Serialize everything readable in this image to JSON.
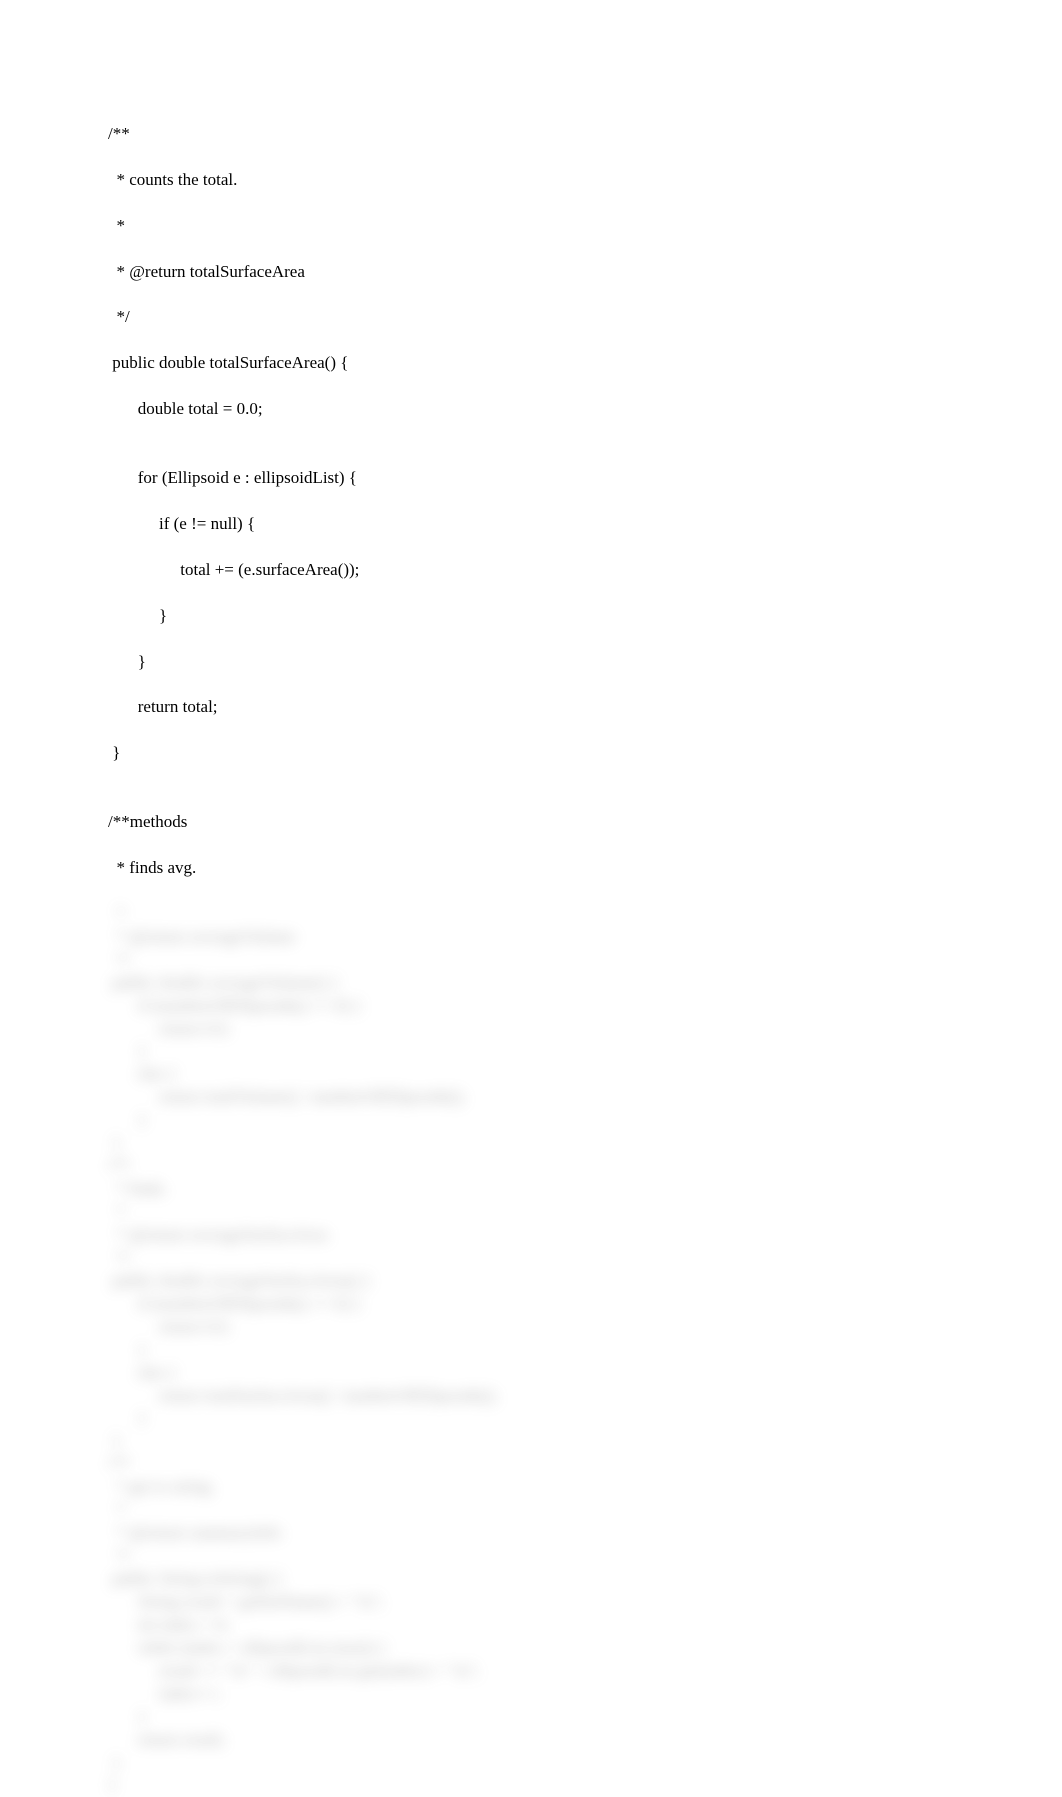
{
  "code": {
    "lines": [
      "/**",
      "  * counts the total.",
      "  *",
      "  * @return totalSurfaceArea",
      "  */",
      " public double totalSurfaceArea() {",
      "       double total = 0.0;",
      "",
      "       for (Ellipsoid e : ellipsoidList) {",
      "            if (e != null) {",
      "                 total += (e.surfaceArea());",
      "            }",
      "       }",
      "       return total;",
      " }",
      "",
      "/**methods",
      "  * finds avg."
    ]
  },
  "blurred": {
    "lines": [
      "  *",
      "  * @return averageVolume",
      "  */",
      " public double averageVolume() {",
      "       if (numberOfEllipsoids() == 0) {",
      "            return 0.0;",
      "       }",
      "       else {",
      "            return totalVolume() / numberOfEllipsoids();",
      "       }",
      " }",
      "",
      "/**",
      "  * finds.",
      "  *",
      "  * @return averageSurfaceArea",
      "  */",
      " public double averageSurfaceArea() {",
      "       if (numberOfEllipsoids() == 0) {",
      "            return 0.0;",
      "       }",
      "       else {",
      "            return totalSurfaceArea() / numberOfEllipsoids();",
      "       }",
      " }",
      "/**",
      "  * get to string.",
      "  *",
      "  * @return summaryInfo",
      "  */",
      " public String toString() {",
      "       String result = getlistName() + \"\\n\";",
      "       int index = 0;",
      "       while (index < ellipsoidList.size()) {",
      "            result += \"\\n\" + ellipsoidList.get(index) + \"\\n\";",
      "            index++;",
      "       }",
      "       return result;",
      " }",
      "}"
    ]
  }
}
